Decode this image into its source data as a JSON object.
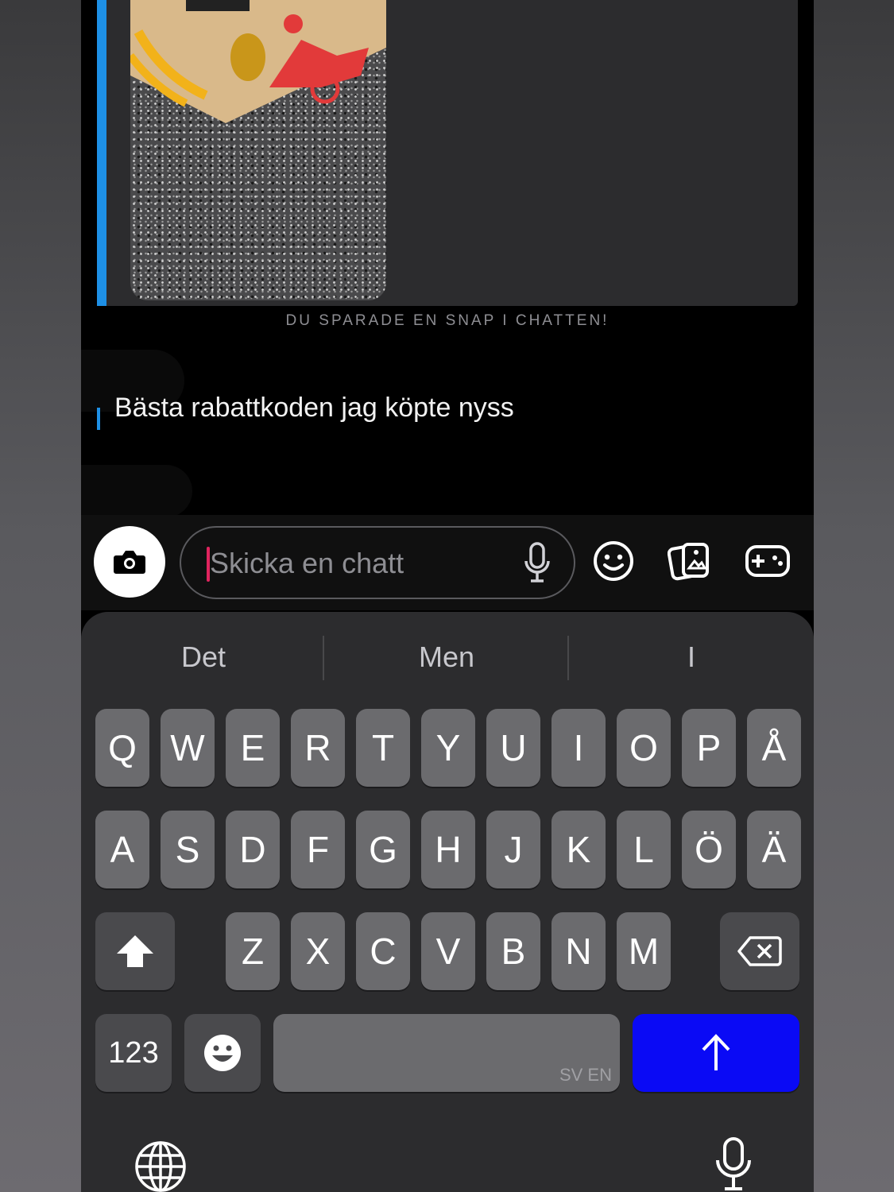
{
  "snap": {
    "saved_label": "DU SPARADE EN SNAP I CHATTEN!"
  },
  "message": {
    "text": "Bästa rabattkoden jag köpte nyss"
  },
  "chat_bar": {
    "placeholder": "Skicka en chatt",
    "icons": [
      "camera-icon",
      "microphone-icon",
      "smiley-icon",
      "memories-icon",
      "games-icon"
    ]
  },
  "keyboard": {
    "suggestions": [
      "Det",
      "Men",
      "I"
    ],
    "row1": [
      "Q",
      "W",
      "E",
      "R",
      "T",
      "Y",
      "U",
      "I",
      "O",
      "P",
      "Å"
    ],
    "row2": [
      "A",
      "S",
      "D",
      "F",
      "G",
      "H",
      "J",
      "K",
      "L",
      "Ö",
      "Ä"
    ],
    "row3": [
      "Z",
      "X",
      "C",
      "V",
      "B",
      "N",
      "M"
    ],
    "numbers_label": "123",
    "space_lang": "SV EN",
    "send_color": "#0a0af5"
  },
  "colors": {
    "accent_blue": "#1e90e6",
    "caret": "#e0245e"
  }
}
